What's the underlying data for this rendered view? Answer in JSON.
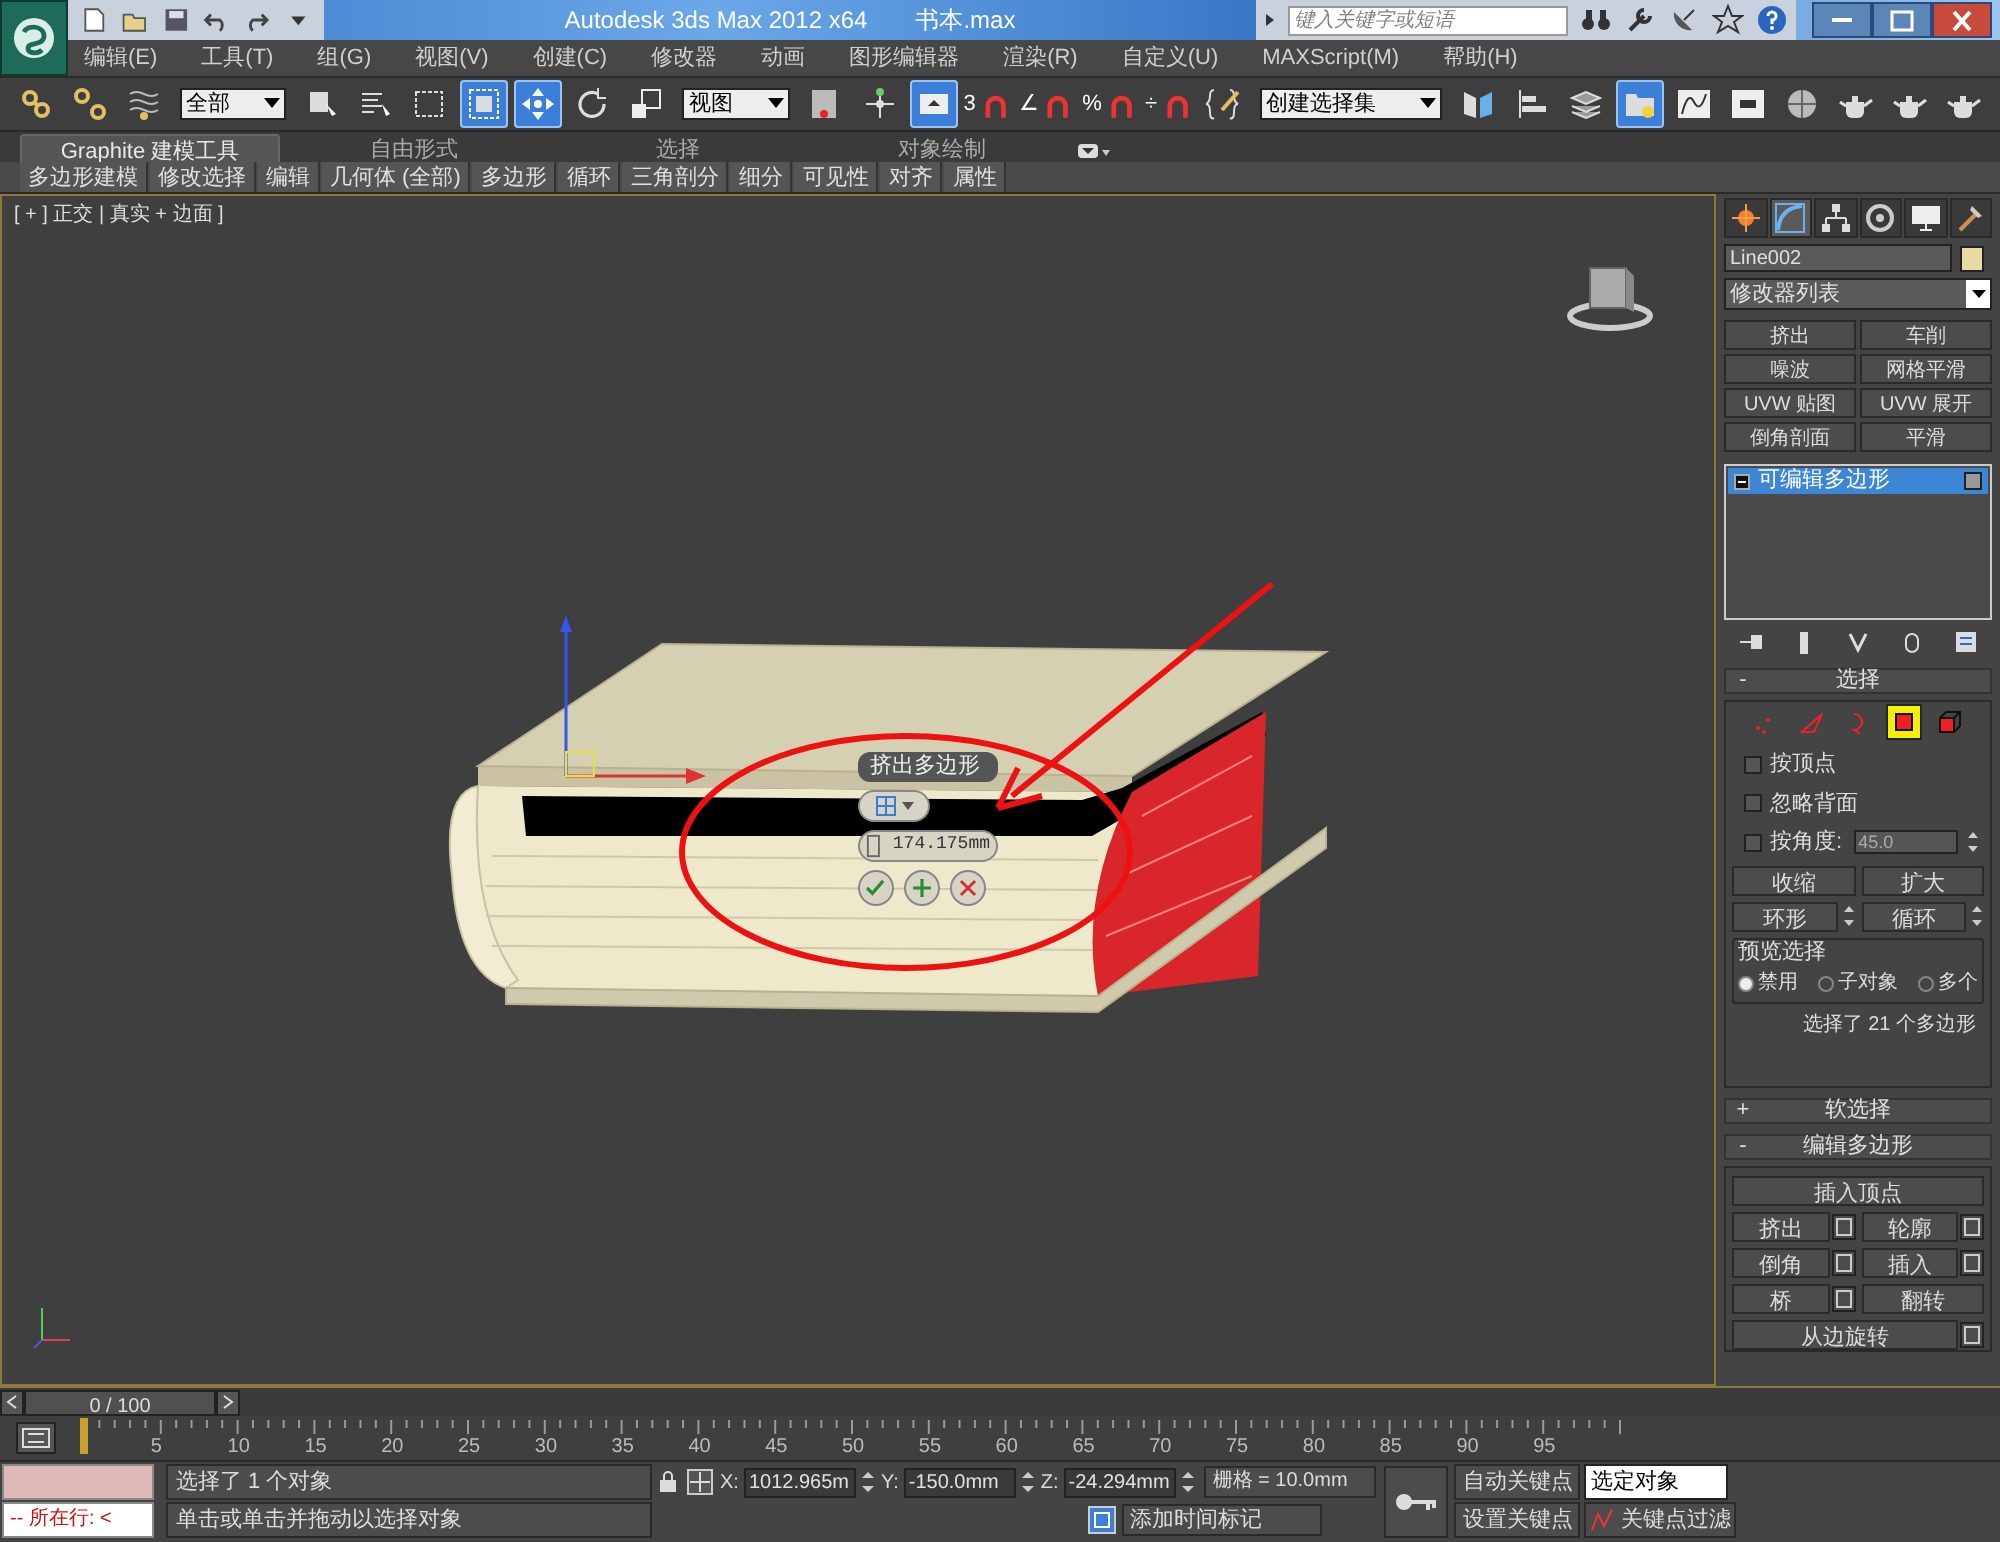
{
  "title_bar": {
    "title": "Autodesk 3ds Max  2012 x64",
    "file": "书本.max",
    "search": {
      "placeholder": "键入关键字或短语"
    }
  },
  "menu": [
    "编辑(E)",
    "工具(T)",
    "组(G)",
    "视图(V)",
    "创建(C)",
    "修改器",
    "动画",
    "图形编辑器",
    "渲染(R)",
    "自定义(U)",
    "MAXScript(M)",
    "帮助(H)"
  ],
  "toolbar": [
    {
      "kind": "link",
      "selected": false
    },
    {
      "kind": "unlink",
      "selected": false
    },
    {
      "kind": "bind",
      "selected": false
    },
    {
      "kind": "dropdown",
      "value": "全部"
    },
    {
      "kind": "select",
      "selected": false
    },
    {
      "kind": "select-list",
      "selected": false
    },
    {
      "kind": "region",
      "selected": false
    },
    {
      "kind": "crossing",
      "selected": true
    },
    {
      "kind": "move",
      "selected": true
    },
    {
      "kind": "rotate",
      "selected": false
    },
    {
      "kind": "scale",
      "selected": false
    },
    {
      "kind": "dropdown",
      "value": "视图"
    },
    {
      "kind": "pivot",
      "selected": false
    },
    {
      "kind": "manipulate",
      "selected": false
    },
    {
      "kind": "keyboard",
      "selected": true
    },
    {
      "kind": "snap",
      "selected": false,
      "label": "3"
    },
    {
      "kind": "snap",
      "selected": false,
      "label": "∠"
    },
    {
      "kind": "snap",
      "selected": false,
      "label": "%"
    },
    {
      "kind": "snap",
      "selected": false,
      "label": "÷"
    },
    {
      "kind": "named-sets",
      "selected": false
    },
    {
      "kind": "dropdown",
      "value": "创建选择集"
    },
    {
      "kind": "mirror",
      "selected": false
    },
    {
      "kind": "align",
      "selected": false
    },
    {
      "kind": "layers",
      "selected": false
    },
    {
      "kind": "explorer",
      "selected": true
    },
    {
      "kind": "curve",
      "selected": false
    },
    {
      "kind": "schematic",
      "selected": false
    },
    {
      "kind": "material",
      "selected": false
    },
    {
      "kind": "teapot",
      "selected": false
    },
    {
      "kind": "teapot",
      "selected": false
    },
    {
      "kind": "teapot",
      "selected": false
    }
  ],
  "ribbon": {
    "tabs": [
      {
        "label": "Graphite 建模工具",
        "selected": true
      },
      {
        "label": "自由形式",
        "selected": false
      },
      {
        "label": "选择",
        "selected": false
      },
      {
        "label": "对象绘制",
        "selected": false
      }
    ],
    "panels": [
      "多边形建模",
      "修改选择",
      "编辑",
      "几何体 (全部)",
      "多边形",
      "循环",
      "三角剖分",
      "细分",
      "可见性",
      "对齐",
      "属性"
    ]
  },
  "viewport": {
    "label": "[ + ] 正交 | 真实 + 边面 ]",
    "caddy": {
      "title": "挤出多边形",
      "value": "174.175mm"
    }
  },
  "command_panel": {
    "tabs": [
      {
        "kind": "create",
        "selected": false
      },
      {
        "kind": "modify",
        "selected": true
      },
      {
        "kind": "hierarchy",
        "selected": false
      },
      {
        "kind": "motion",
        "selected": false
      },
      {
        "kind": "display",
        "selected": false
      },
      {
        "kind": "utilities",
        "selected": false
      }
    ],
    "object_name": "Line002",
    "modifier_list": "修改器列表",
    "modifier_buttons": [
      "挤出",
      "车削",
      "噪波",
      "网格平滑",
      "UVW 贴图",
      "UVW 展开",
      "倒角剖面",
      "平滑"
    ],
    "stack": [
      {
        "label": "可编辑多边形",
        "selected": true
      }
    ],
    "selection": {
      "toggle": "-",
      "title": "选择",
      "subobjects": [
        {
          "kind": "vertex",
          "selected": false
        },
        {
          "kind": "edge",
          "selected": false
        },
        {
          "kind": "border",
          "selected": false
        },
        {
          "kind": "polygon",
          "selected": true
        },
        {
          "kind": "element",
          "selected": false
        }
      ],
      "checkboxes": [
        {
          "label": "按顶点",
          "checked": false
        },
        {
          "label": "忽略背面",
          "checked": false
        },
        {
          "label": "按角度:",
          "checked": false
        }
      ],
      "angle": "45.0",
      "buttons": [
        "收缩",
        "扩大"
      ],
      "spinner_buttons": [
        "环形",
        "循环"
      ],
      "preview": {
        "title": "预览选择",
        "options": [
          {
            "label": "禁用",
            "selected": true
          },
          {
            "label": "子对象",
            "selected": false
          },
          {
            "label": "多个",
            "selected": false
          }
        ]
      },
      "info": "选择了 21 个多边形"
    },
    "soft_selection": {
      "toggle": "+",
      "title": "软选择"
    },
    "edit_polygons": {
      "toggle": "-",
      "title": "编辑多边形",
      "rows": [
        [
          {
            "label": "插入顶点",
            "has_settings": false
          }
        ],
        [
          {
            "label": "挤出",
            "has_settings": true
          },
          {
            "label": "轮廓",
            "has_settings": true
          }
        ],
        [
          {
            "label": "倒角",
            "has_settings": true
          },
          {
            "label": "插入",
            "has_settings": true
          }
        ],
        [
          {
            "label": "桥",
            "has_settings": true
          },
          {
            "label": "翻转",
            "has_settings": false
          }
        ],
        [
          {
            "label": "从边旋转",
            "has_settings": true
          }
        ]
      ]
    }
  },
  "time_slider": {
    "label": "0 / 100",
    "level": 0
  },
  "track_bar": {
    "ticks": [
      "5",
      "10",
      "15",
      "20",
      "25",
      "30",
      "35",
      "40",
      "45",
      "50",
      "55",
      "60",
      "65",
      "70",
      "75",
      "80",
      "85",
      "90",
      "95"
    ]
  },
  "status_bar": {
    "listener": "-- 所在行: <",
    "prompt": "选择了 1 个对象",
    "hint": "单击或单击并拖动以选择对象",
    "coords": [
      {
        "label": "X:",
        "value": "1012.965m"
      },
      {
        "label": "Y:",
        "value": "-150.0mm"
      },
      {
        "label": "Z:",
        "value": "-24.294mm"
      }
    ],
    "grid": "栅格 = 10.0mm",
    "time_tag": "添加时间标记",
    "auto_key": "自动关键点",
    "set_key": "设置关键点",
    "key_mode": "选定对象",
    "key_filters": "关键点过滤"
  }
}
